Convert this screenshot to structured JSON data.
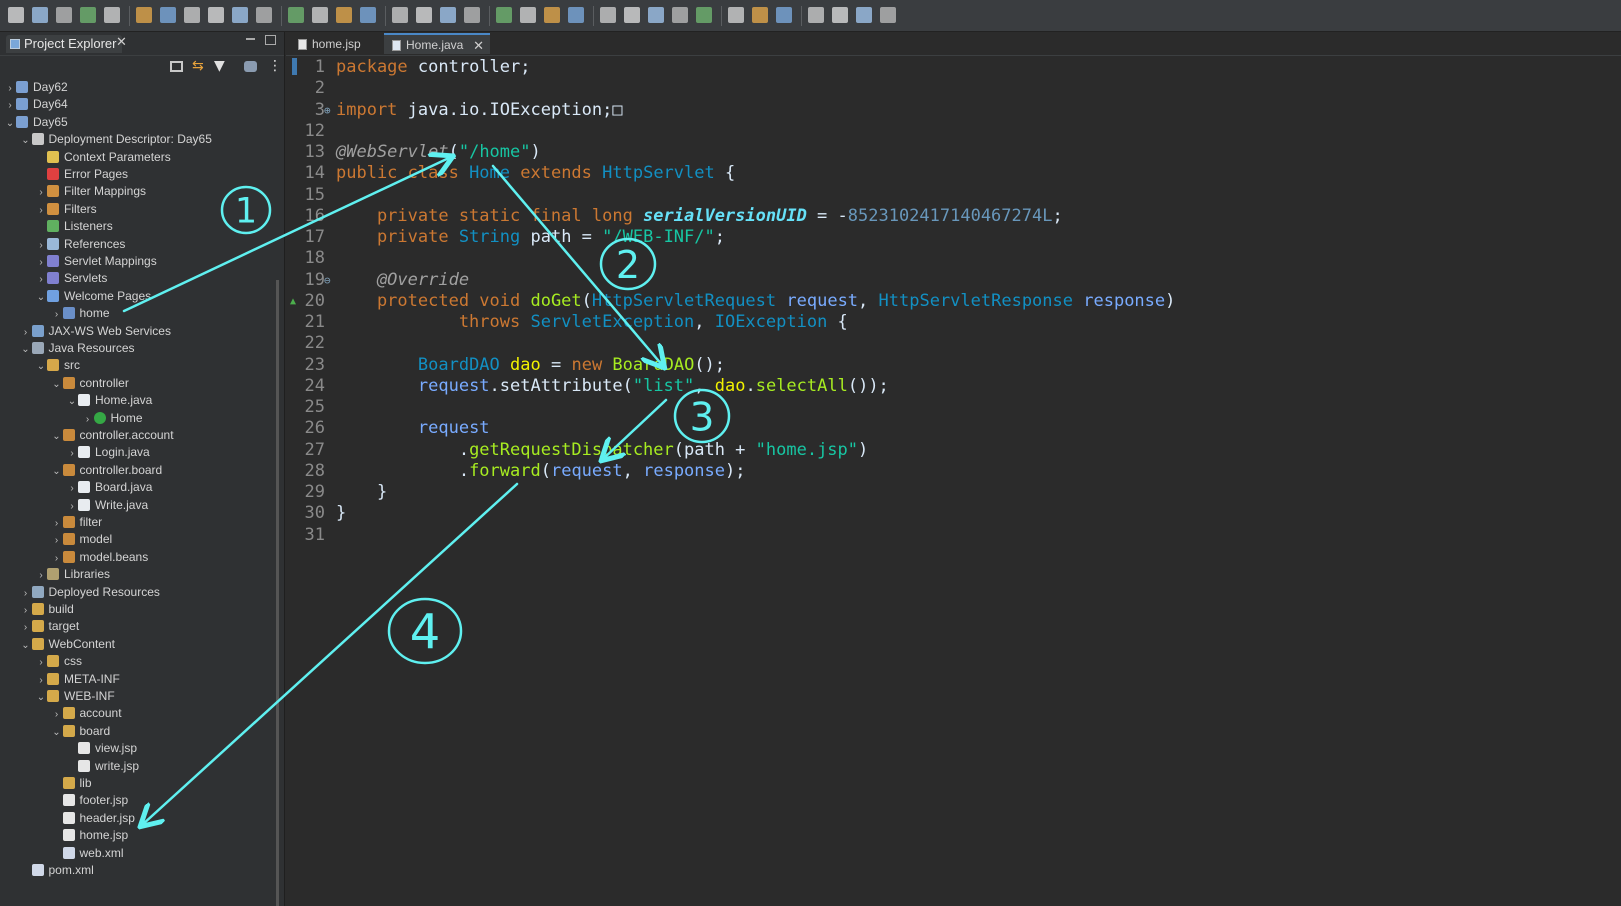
{
  "toolbar": {
    "icons": [
      "new-icon",
      "save-icon",
      "save-all-icon",
      "print-icon",
      "terminal-icon",
      "resume-icon",
      "suspend-icon",
      "terminate-icon",
      "disconnect-icon",
      "step-into-icon",
      "step-over-icon",
      "step-return-icon",
      "drop-to-frame-icon",
      "use-step-filters-icon",
      "toggle-breakpoint-icon",
      "mark-occurrences-icon",
      "toggle-block-selection-icon",
      "word-wrap-icon",
      "show-whitespace-icon",
      "debug-icon",
      "run-icon",
      "run-external-icon",
      "new-server-icon",
      "coverage-icon",
      "open-type-icon",
      "open-task-icon",
      "search-icon",
      "web-browser-icon",
      "open-perspective-icon",
      "back-icon",
      "forward-icon",
      "last-edit-icon",
      "prev-annotation-icon",
      "next-annotation-icon",
      "perspective-icon"
    ]
  },
  "explorer": {
    "title": "Project Explorer",
    "close_glyph": "✕",
    "tree": [
      {
        "label": "Day62",
        "indent": 0,
        "twisty": "›",
        "icon": "project"
      },
      {
        "label": "Day64",
        "indent": 0,
        "twisty": "›",
        "icon": "project"
      },
      {
        "label": "Day65",
        "indent": 0,
        "twisty": "⌄",
        "icon": "project"
      },
      {
        "label": "Deployment Descriptor: Day65",
        "indent": 1,
        "twisty": "⌄",
        "icon": "descriptor"
      },
      {
        "label": "Context Parameters",
        "indent": 2,
        "twisty": "",
        "icon": "param"
      },
      {
        "label": "Error Pages",
        "indent": 2,
        "twisty": "",
        "icon": "error"
      },
      {
        "label": "Filter Mappings",
        "indent": 2,
        "twisty": "›",
        "icon": "filter"
      },
      {
        "label": "Filters",
        "indent": 2,
        "twisty": "›",
        "icon": "filter"
      },
      {
        "label": "Listeners",
        "indent": 2,
        "twisty": "",
        "icon": "listener"
      },
      {
        "label": "References",
        "indent": 2,
        "twisty": "›",
        "icon": "ref"
      },
      {
        "label": "Servlet Mappings",
        "indent": 2,
        "twisty": "›",
        "icon": "servlet"
      },
      {
        "label": "Servlets",
        "indent": 2,
        "twisty": "›",
        "icon": "servlet"
      },
      {
        "label": "Welcome Pages",
        "indent": 2,
        "twisty": "⌄",
        "icon": "welcome"
      },
      {
        "label": "home",
        "indent": 3,
        "twisty": "›",
        "icon": "page"
      },
      {
        "label": "JAX-WS Web Services",
        "indent": 1,
        "twisty": "›",
        "icon": "ws"
      },
      {
        "label": "Java Resources",
        "indent": 1,
        "twisty": "⌄",
        "icon": "javares"
      },
      {
        "label": "src",
        "indent": 2,
        "twisty": "⌄",
        "icon": "srcfolder"
      },
      {
        "label": "controller",
        "indent": 3,
        "twisty": "⌄",
        "icon": "package"
      },
      {
        "label": "Home.java",
        "indent": 4,
        "twisty": "⌄",
        "icon": "java"
      },
      {
        "label": "Home",
        "indent": 5,
        "twisty": "›",
        "icon": "class"
      },
      {
        "label": "controller.account",
        "indent": 3,
        "twisty": "⌄",
        "icon": "package"
      },
      {
        "label": "Login.java",
        "indent": 4,
        "twisty": "›",
        "icon": "java"
      },
      {
        "label": "controller.board",
        "indent": 3,
        "twisty": "⌄",
        "icon": "package"
      },
      {
        "label": "Board.java",
        "indent": 4,
        "twisty": "›",
        "icon": "java"
      },
      {
        "label": "Write.java",
        "indent": 4,
        "twisty": "›",
        "icon": "java"
      },
      {
        "label": "filter",
        "indent": 3,
        "twisty": "›",
        "icon": "package"
      },
      {
        "label": "model",
        "indent": 3,
        "twisty": "›",
        "icon": "package"
      },
      {
        "label": "model.beans",
        "indent": 3,
        "twisty": "›",
        "icon": "package"
      },
      {
        "label": "Libraries",
        "indent": 2,
        "twisty": "›",
        "icon": "lib"
      },
      {
        "label": "Deployed Resources",
        "indent": 1,
        "twisty": "›",
        "icon": "deployed"
      },
      {
        "label": "build",
        "indent": 1,
        "twisty": "›",
        "icon": "folder"
      },
      {
        "label": "target",
        "indent": 1,
        "twisty": "›",
        "icon": "folder"
      },
      {
        "label": "WebContent",
        "indent": 1,
        "twisty": "⌄",
        "icon": "folder"
      },
      {
        "label": "css",
        "indent": 2,
        "twisty": "›",
        "icon": "folder"
      },
      {
        "label": "META-INF",
        "indent": 2,
        "twisty": "›",
        "icon": "folder"
      },
      {
        "label": "WEB-INF",
        "indent": 2,
        "twisty": "⌄",
        "icon": "folder"
      },
      {
        "label": "account",
        "indent": 3,
        "twisty": "›",
        "icon": "folder"
      },
      {
        "label": "board",
        "indent": 3,
        "twisty": "⌄",
        "icon": "folder"
      },
      {
        "label": "view.jsp",
        "indent": 4,
        "twisty": "",
        "icon": "file"
      },
      {
        "label": "write.jsp",
        "indent": 4,
        "twisty": "",
        "icon": "file"
      },
      {
        "label": "lib",
        "indent": 3,
        "twisty": "",
        "icon": "folder"
      },
      {
        "label": "footer.jsp",
        "indent": 3,
        "twisty": "",
        "icon": "file"
      },
      {
        "label": "header.jsp",
        "indent": 3,
        "twisty": "",
        "icon": "file"
      },
      {
        "label": "home.jsp",
        "indent": 3,
        "twisty": "",
        "icon": "file"
      },
      {
        "label": "web.xml",
        "indent": 3,
        "twisty": "",
        "icon": "xml"
      },
      {
        "label": "pom.xml",
        "indent": 1,
        "twisty": "",
        "icon": "xml"
      }
    ]
  },
  "editor": {
    "tabs": [
      {
        "label": "home.jsp",
        "active": false
      },
      {
        "label": "Home.java",
        "active": true,
        "close": "✕"
      }
    ],
    "lines": [
      {
        "n": "1",
        "tokens": [
          {
            "t": "package",
            "c": "kw"
          },
          {
            "t": " controller;",
            "c": ""
          }
        ]
      },
      {
        "n": "2",
        "tokens": []
      },
      {
        "n": "3",
        "fold": "⊕",
        "tokens": [
          {
            "t": "import",
            "c": "kw"
          },
          {
            "t": " java.io.IOException;",
            "c": ""
          },
          {
            "t": "□",
            "c": ""
          }
        ]
      },
      {
        "n": "12",
        "tokens": []
      },
      {
        "n": "13",
        "tokens": [
          {
            "t": "@WebServlet",
            "c": "ann"
          },
          {
            "t": "(",
            "c": ""
          },
          {
            "t": "\"/home\"",
            "c": "str"
          },
          {
            "t": ")",
            "c": ""
          }
        ]
      },
      {
        "n": "14",
        "tokens": [
          {
            "t": "public class ",
            "c": "kw"
          },
          {
            "t": "Home",
            "c": "typ"
          },
          {
            "t": " extends ",
            "c": "kw"
          },
          {
            "t": "HttpServlet",
            "c": "typ"
          },
          {
            "t": " {",
            "c": ""
          }
        ]
      },
      {
        "n": "15",
        "tokens": []
      },
      {
        "n": "16",
        "tokens": [
          {
            "t": "    private static final long ",
            "c": "kw"
          },
          {
            "t": "serialVersionUID",
            "c": "fld"
          },
          {
            "t": " = -",
            "c": ""
          },
          {
            "t": "8523102417140467274L",
            "c": "num"
          },
          {
            "t": ";",
            "c": ""
          }
        ]
      },
      {
        "n": "17",
        "tokens": [
          {
            "t": "    private ",
            "c": "kw"
          },
          {
            "t": "String",
            "c": "typ"
          },
          {
            "t": " path",
            "c": ""
          },
          {
            "t": " = ",
            "c": ""
          },
          {
            "t": "\"/WEB-INF/\"",
            "c": "str"
          },
          {
            "t": ";",
            "c": ""
          }
        ]
      },
      {
        "n": "18",
        "tokens": []
      },
      {
        "n": "19",
        "fold": "⊖",
        "tokens": [
          {
            "t": "    @Override",
            "c": "ann"
          }
        ]
      },
      {
        "n": "20",
        "marker": "▲",
        "tokens": [
          {
            "t": "    protected void ",
            "c": "kw"
          },
          {
            "t": "doGet",
            "c": "mth"
          },
          {
            "t": "(",
            "c": ""
          },
          {
            "t": "HttpServletRequest",
            "c": "typ"
          },
          {
            "t": " ",
            "c": ""
          },
          {
            "t": "request",
            "c": "prm"
          },
          {
            "t": ", ",
            "c": ""
          },
          {
            "t": "HttpServletResponse",
            "c": "typ"
          },
          {
            "t": " ",
            "c": ""
          },
          {
            "t": "response",
            "c": "prm"
          },
          {
            "t": ")",
            "c": ""
          }
        ]
      },
      {
        "n": "21",
        "tokens": [
          {
            "t": "            throws ",
            "c": "kw"
          },
          {
            "t": "ServletException",
            "c": "typ"
          },
          {
            "t": ", ",
            "c": ""
          },
          {
            "t": "IOException",
            "c": "typ"
          },
          {
            "t": " {",
            "c": ""
          }
        ]
      },
      {
        "n": "22",
        "tokens": []
      },
      {
        "n": "23",
        "tokens": [
          {
            "t": "        ",
            "c": ""
          },
          {
            "t": "BoardDAO",
            "c": "typ"
          },
          {
            "t": " ",
            "c": ""
          },
          {
            "t": "dao",
            "c": "var"
          },
          {
            "t": " = ",
            "c": ""
          },
          {
            "t": "new ",
            "c": "kw"
          },
          {
            "t": "BoardDAO",
            "c": "mth"
          },
          {
            "t": "();",
            "c": ""
          }
        ]
      },
      {
        "n": "24",
        "tokens": [
          {
            "t": "        ",
            "c": ""
          },
          {
            "t": "request",
            "c": "prm"
          },
          {
            "t": ".setAttribute(",
            "c": ""
          },
          {
            "t": "\"list\"",
            "c": "str"
          },
          {
            "t": ", ",
            "c": ""
          },
          {
            "t": "dao",
            "c": "var"
          },
          {
            "t": ".",
            "c": ""
          },
          {
            "t": "selectAll",
            "c": "mth"
          },
          {
            "t": "());",
            "c": ""
          }
        ]
      },
      {
        "n": "25",
        "tokens": []
      },
      {
        "n": "26",
        "tokens": [
          {
            "t": "        ",
            "c": ""
          },
          {
            "t": "request",
            "c": "prm"
          }
        ]
      },
      {
        "n": "27",
        "tokens": [
          {
            "t": "            .",
            "c": ""
          },
          {
            "t": "getRequestDispatcher",
            "c": "mth"
          },
          {
            "t": "(path + ",
            "c": ""
          },
          {
            "t": "\"home.jsp\"",
            "c": "str"
          },
          {
            "t": ")",
            "c": ""
          }
        ]
      },
      {
        "n": "28",
        "tokens": [
          {
            "t": "            .",
            "c": ""
          },
          {
            "t": "forward",
            "c": "mth"
          },
          {
            "t": "(",
            "c": ""
          },
          {
            "t": "request",
            "c": "prm"
          },
          {
            "t": ", ",
            "c": ""
          },
          {
            "t": "response",
            "c": "prm"
          },
          {
            "t": ");",
            "c": ""
          }
        ]
      },
      {
        "n": "29",
        "tokens": [
          {
            "t": "    }",
            "c": ""
          }
        ]
      },
      {
        "n": "30",
        "tokens": [
          {
            "t": "}",
            "c": ""
          }
        ]
      },
      {
        "n": "31",
        "tokens": []
      }
    ]
  },
  "annotations": {
    "color": "#5ff0f0",
    "labels": [
      "1",
      "2",
      "3",
      "4"
    ]
  },
  "colors": {
    "keyword": "#cc7832",
    "string": "#17c6a3",
    "type": "#1290c3",
    "annotation_arrow": "#5ff0f0"
  }
}
